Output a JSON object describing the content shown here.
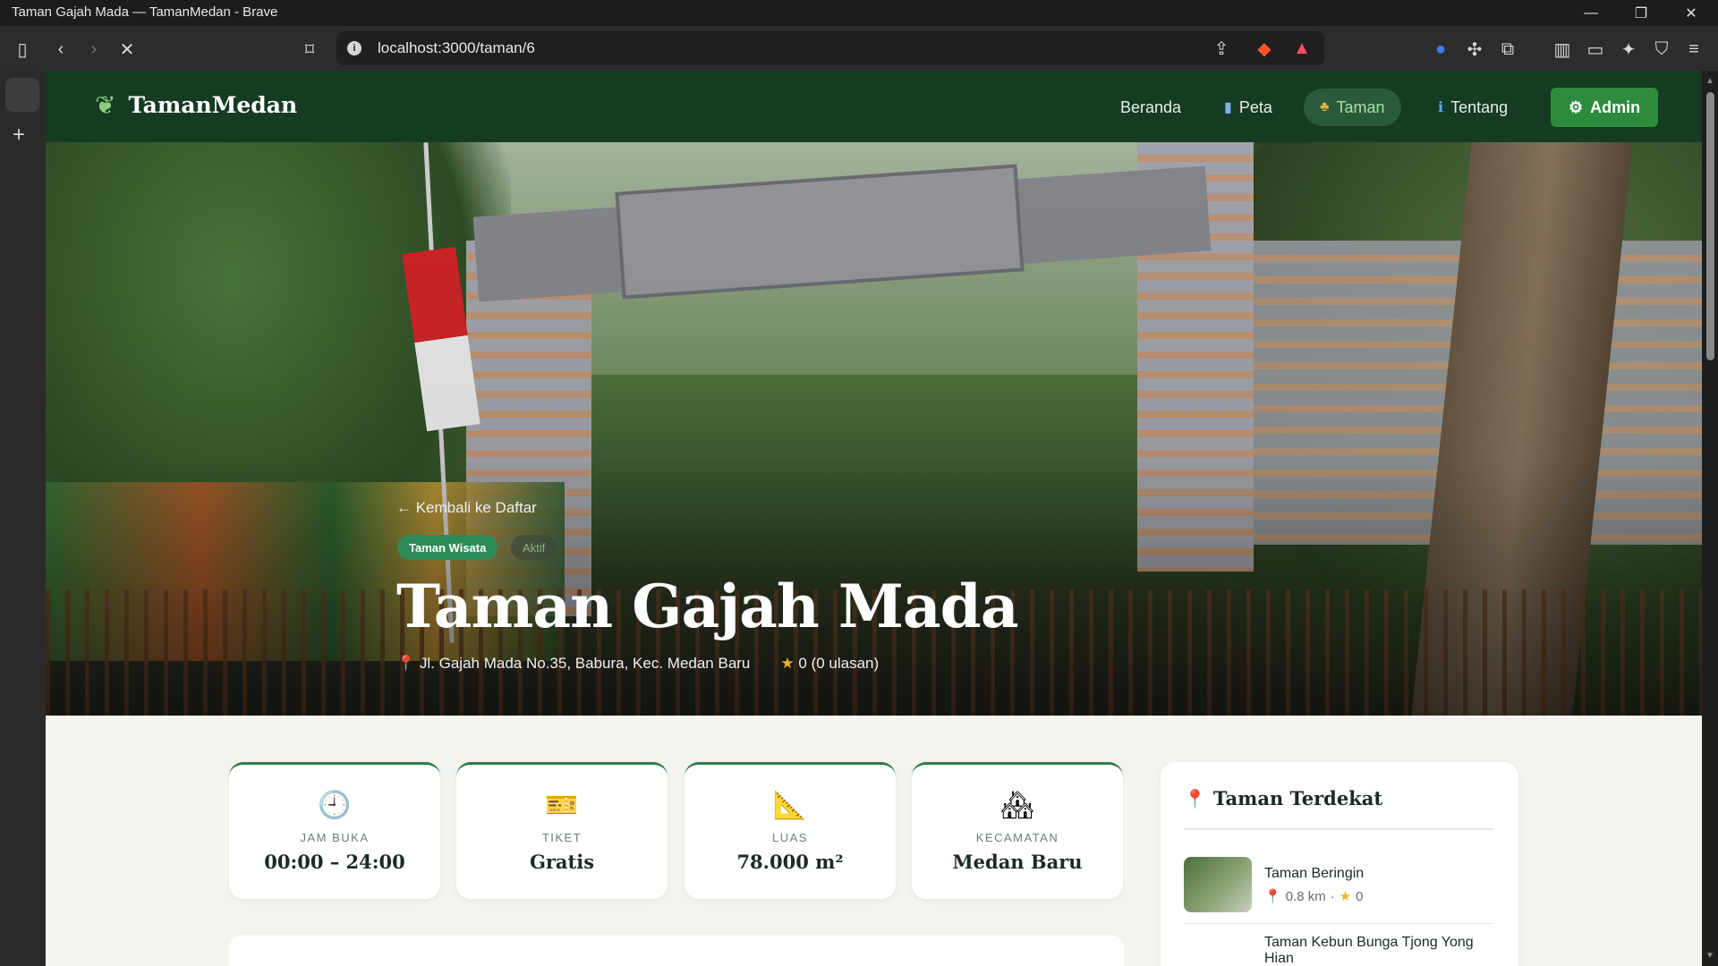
{
  "browser": {
    "window_title": "Taman Gajah Mada — TamanMedan - Brave",
    "url": "localhost:3000/taman/6"
  },
  "nav": {
    "brand": "TamanMedan",
    "links": [
      {
        "label": "Beranda",
        "icon": ""
      },
      {
        "label": "Peta",
        "icon": "map-book-icon"
      },
      {
        "label": "Taman",
        "icon": "tree-icon"
      },
      {
        "label": "Tentang",
        "icon": "info-icon"
      }
    ],
    "active": "Taman",
    "admin_label": "Admin"
  },
  "hero": {
    "back_label": "← Kembali ke Daftar",
    "category": "Taman Wisata",
    "status": "Aktif",
    "title": "Taman Gajah Mada",
    "address": "Jl. Gajah Mada No.35, Babura, Kec. Medan Baru",
    "rating": "0 (0 ulasan)"
  },
  "stats": [
    {
      "icon": "clock-icon",
      "label": "JAM BUKA",
      "value": "00:00 – 24:00"
    },
    {
      "icon": "ticket-icon",
      "label": "TIKET",
      "value": "Gratis"
    },
    {
      "icon": "ruler-icon",
      "label": "LUAS",
      "value": "78.000 m²"
    },
    {
      "icon": "house-icon",
      "label": "KECAMATAN",
      "value": "Medan Baru"
    }
  ],
  "nearby": {
    "title": "Taman Terdekat",
    "items": [
      {
        "name": "Taman Beringin",
        "distance": "0.8 km",
        "rating": "0"
      },
      {
        "name": "Taman Kebun Bunga Tjong Yong Hian",
        "distance": "",
        "rating": ""
      }
    ]
  },
  "colors": {
    "nav_bg": "#153b22",
    "accent": "#2e8b3e",
    "page_bg": "#f6f4ef"
  }
}
